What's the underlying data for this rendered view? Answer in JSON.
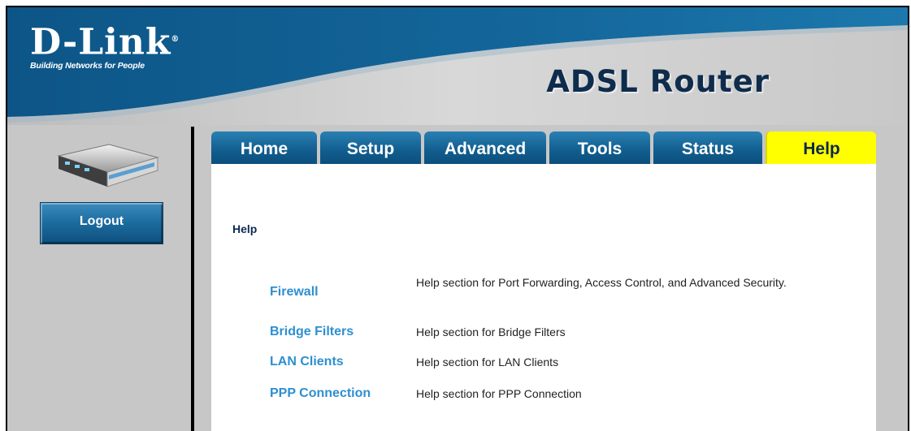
{
  "brand": {
    "logo_main": "D-Link",
    "logo_reg": "®",
    "tagline": "Building Networks for People",
    "product_title": "ADSL Router"
  },
  "sidebar": {
    "logout_label": "Logout"
  },
  "tabs": [
    {
      "label": "Home",
      "active": false
    },
    {
      "label": "Setup",
      "active": false
    },
    {
      "label": "Advanced",
      "active": false
    },
    {
      "label": "Tools",
      "active": false
    },
    {
      "label": "Status",
      "active": false
    },
    {
      "label": "Help",
      "active": true
    }
  ],
  "content": {
    "title": "Help",
    "items": [
      {
        "link": "Firewall",
        "description": "Help section for Port Forwarding, Access Control, and Advanced Security."
      },
      {
        "link": "Bridge Filters",
        "description": "Help section for Bridge Filters"
      },
      {
        "link": "LAN Clients",
        "description": "Help section for LAN Clients"
      },
      {
        "link": "PPP Connection",
        "description": "Help section for PPP Connection"
      }
    ]
  },
  "colors": {
    "header_blue": "#0f5a8a",
    "tab_active": "#ffff00",
    "link_blue": "#2d8fd0",
    "background_gray": "#c7c7c7"
  }
}
